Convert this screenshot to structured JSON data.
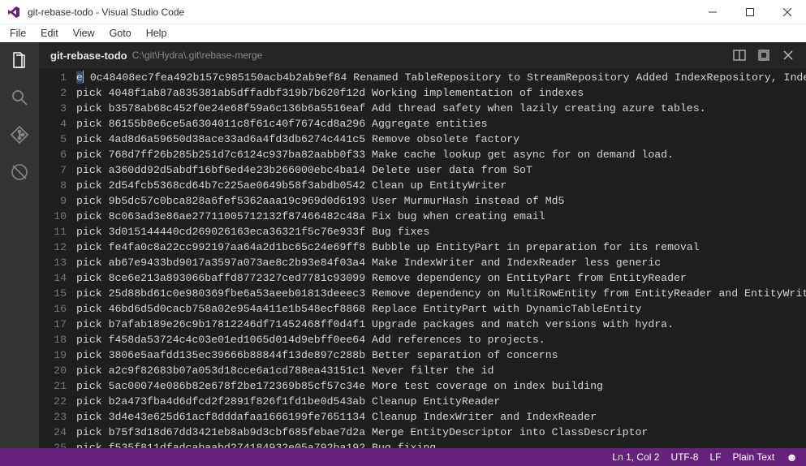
{
  "window": {
    "title": "git-rebase-todo - Visual Studio Code"
  },
  "menu": {
    "file": "File",
    "edit": "Edit",
    "view": "View",
    "goto": "Goto",
    "help": "Help"
  },
  "tab": {
    "title": "git-rebase-todo",
    "path": "C:\\git\\Hydra\\.git\\rebase-merge"
  },
  "editor": {
    "first_cmd": "e",
    "first_hash": "0c48408ec7fea492b157c985150acb4b2ab9ef84",
    "first_msg": "Renamed TableRepository to StreamRepository Added IndexRepository, IndexC",
    "lines": [
      {
        "cmd": "pick",
        "hash": "4048f1ab87a835381ab5dffadbf319b7b620f12d",
        "msg": "Working implementation of indexes"
      },
      {
        "cmd": "pick",
        "hash": "b3578ab68c452f0e24e68f59a6c136b6a5516eaf",
        "msg": "Add thread safety when lazily creating azure tables."
      },
      {
        "cmd": "pick",
        "hash": "86155b8e6ce5a6304011c8f61c40f7674cd8a296",
        "msg": "Aggregate entities"
      },
      {
        "cmd": "pick",
        "hash": "4ad8d6a59650d38ace33ad6a4fd3db6274c441c5",
        "msg": "Remove obsolete factory"
      },
      {
        "cmd": "pick",
        "hash": "768d7ff26b285b251d7c6124c937ba82aabb0f33",
        "msg": "Make cache lookup get async for on demand load."
      },
      {
        "cmd": "pick",
        "hash": "a360dd92d5abdf16bf6ed4e23b266000ebc4ba14",
        "msg": "Delete user data from SoT"
      },
      {
        "cmd": "pick",
        "hash": "2d54fcb5368cd64b7c225ae0649b58f3abdb0542",
        "msg": "Clean up EntityWriter"
      },
      {
        "cmd": "pick",
        "hash": "9b5dc57c0bca828a6fef5362aaa19c969d0d6193",
        "msg": "User MurmurHash instead of Md5"
      },
      {
        "cmd": "pick",
        "hash": "8c063ad3e86ae27711005712132f87466482c48a",
        "msg": "Fix bug when creating email"
      },
      {
        "cmd": "pick",
        "hash": "3d015144440cd269026163eca36321f5c76e933f",
        "msg": "Bug fixes"
      },
      {
        "cmd": "pick",
        "hash": "fe4fa0c8a22cc992197aa64a2d1bc65c24e69ff8",
        "msg": "Bubble up EntityPart in preparation for its removal"
      },
      {
        "cmd": "pick",
        "hash": "ab67e9433bd9017a3597a073ae8c2b93e84f03a4",
        "msg": "Make IndexWriter and IndexReader less generic"
      },
      {
        "cmd": "pick",
        "hash": "8ce6e213a893066baffd8772327ced7781c93099",
        "msg": "Remove dependency on EntityPart from EntityReader"
      },
      {
        "cmd": "pick",
        "hash": "25d88bd61c0e980369fbe6a53aeeb01813deeec3",
        "msg": "Remove dependency on MultiRowEntity from EntityReader and EntityWriter"
      },
      {
        "cmd": "pick",
        "hash": "46bd6d5d0cacb758a02e954a411e1b548ecf8868",
        "msg": "Replace EntityPart with DynamicTableEntity"
      },
      {
        "cmd": "pick",
        "hash": "b7afab189e26c9b17812246df71452468ff0d4f1",
        "msg": "Upgrade packages and match versions with hydra."
      },
      {
        "cmd": "pick",
        "hash": "f458da53724c4c03e01ed1065d014d9ebff0ee64",
        "msg": "Add references to projects."
      },
      {
        "cmd": "pick",
        "hash": "3806e5aafdd135ec39666b88844f13de897c288b",
        "msg": "Better separation of concerns"
      },
      {
        "cmd": "pick",
        "hash": "a2c9f82683b07a053d18cce6a1cd788ea43151c1",
        "msg": "Never filter the id"
      },
      {
        "cmd": "pick",
        "hash": "5ac00074e086b82e678f2be172369b85cf57c34e",
        "msg": "More test coverage on index building"
      },
      {
        "cmd": "pick",
        "hash": "b2a473fba4d6dfcd2f2891f826f1fd1be0d543ab",
        "msg": "Cleanup EntityReader"
      },
      {
        "cmd": "pick",
        "hash": "3d4e43e625d61acf8dddafaa1666199fe7651134",
        "msg": "Cleanup IndexWriter and IndexReader"
      },
      {
        "cmd": "pick",
        "hash": "b75f3d18d67dd3421eb8ab9d3cbf685febae7d2a",
        "msg": "Merge EntityDescriptor into ClassDescriptor"
      },
      {
        "cmd": "pick",
        "hash": "f535f811dfadcabaabd274184932e05a792ba192",
        "msg": "Bug fixing"
      }
    ]
  },
  "status": {
    "position": "Ln 1, Col 2",
    "encoding": "UTF-8",
    "eol": "LF",
    "language": "Plain Text"
  }
}
